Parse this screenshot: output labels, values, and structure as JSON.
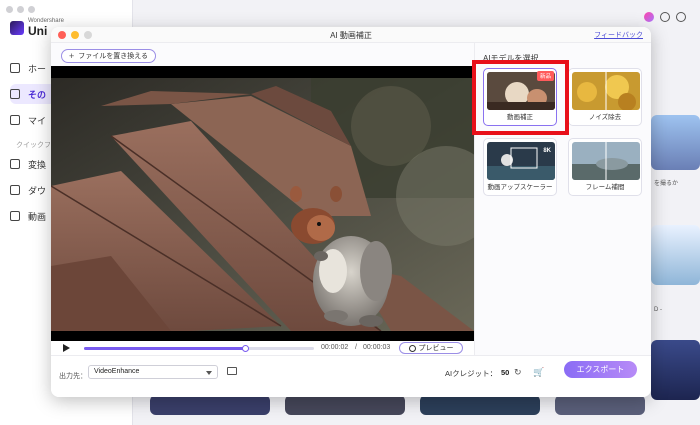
{
  "background_app": {
    "logo_small": "Wondershare",
    "logo_big": "Uni",
    "nav": [
      {
        "label": "ホー",
        "icon": "home-icon"
      },
      {
        "label": "その",
        "icon": "toolbox-icon"
      },
      {
        "label": "マイ",
        "icon": "folder-icon"
      },
      {
        "label": "変換",
        "icon": "convert-icon"
      },
      {
        "label": "ダウ",
        "icon": "download-icon"
      },
      {
        "label": "動画",
        "icon": "video-editor-icon"
      }
    ],
    "quick_label": "クイックフ",
    "right_text_1": "を撮るか",
    "right_text_2": "D -"
  },
  "dialog": {
    "title": "AI 動画補正",
    "feedback": "フィードバック",
    "replace_button": "ファイルを置き換える",
    "controls": {
      "current_time": "00:00:02",
      "separator": "/",
      "total_time": "00:00:03",
      "progress": 0.7,
      "preview_label": "プレビュー"
    },
    "models_title": "AIモデルを選択",
    "models": [
      {
        "label": "動画補正",
        "badge": "新品",
        "selected": true
      },
      {
        "label": "ノイズ除去",
        "badge": "",
        "selected": false
      },
      {
        "label": "動画アップスケーラー",
        "badge": "",
        "selected": false
      },
      {
        "label": "フレーム補間",
        "badge": "",
        "selected": false
      }
    ],
    "upscale_badge": "8K",
    "footer": {
      "output_label": "出力先：",
      "output_value": "VideoEnhance",
      "credit_label": "AIクレジット：",
      "credit_value": "50",
      "export_button": "エクスポート"
    }
  }
}
